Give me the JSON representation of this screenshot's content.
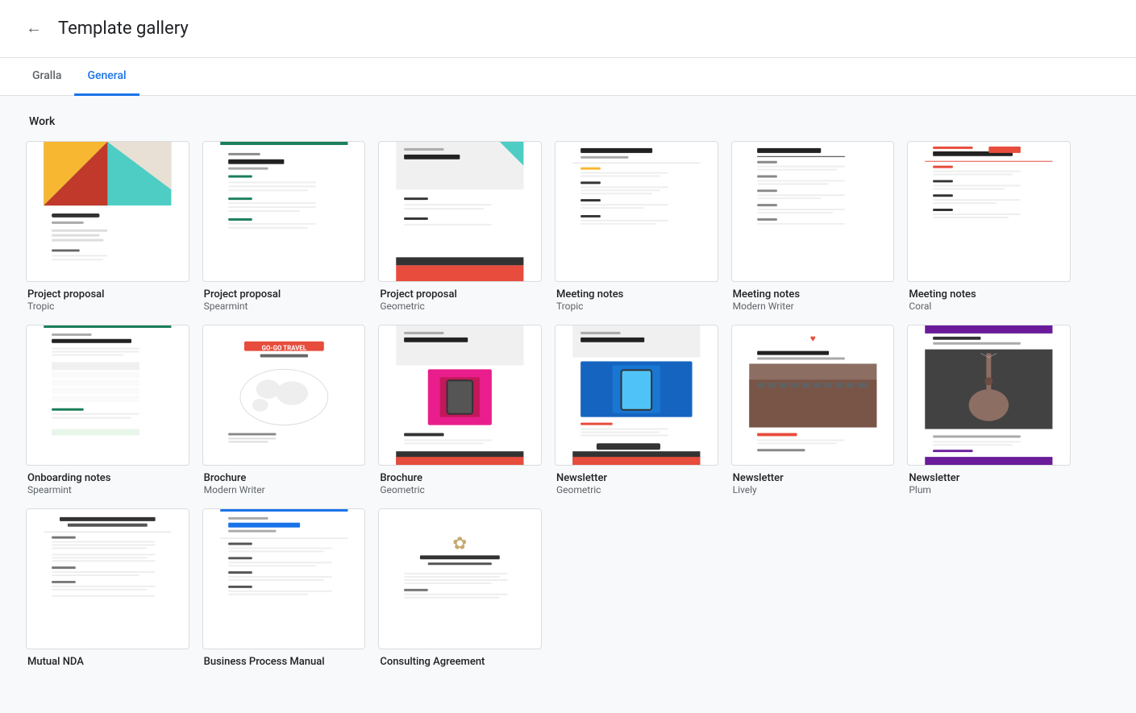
{
  "header": {
    "back_label": "←",
    "title": "Template gallery"
  },
  "tabs": [
    {
      "id": "gralla",
      "label": "Gralla",
      "active": false
    },
    {
      "id": "general",
      "label": "General",
      "active": true
    }
  ],
  "sections": [
    {
      "id": "work",
      "label": "Work",
      "templates": [
        {
          "id": "pp-tropic",
          "name": "Project proposal",
          "sub": "Tropic",
          "thumb_type": "project-proposal-tropic"
        },
        {
          "id": "pp-spearmint",
          "name": "Project proposal",
          "sub": "Spearmint",
          "thumb_type": "project-proposal-spearmint"
        },
        {
          "id": "pp-geometric",
          "name": "Project proposal",
          "sub": "Geometric",
          "thumb_type": "project-proposal-geometric"
        },
        {
          "id": "mn-tropic",
          "name": "Meeting notes",
          "sub": "Tropic",
          "thumb_type": "meeting-notes-tropic"
        },
        {
          "id": "mn-modern",
          "name": "Meeting notes",
          "sub": "Modern Writer",
          "thumb_type": "meeting-notes-modern"
        },
        {
          "id": "mn-coral",
          "name": "Meeting notes",
          "sub": "Coral",
          "thumb_type": "meeting-notes-coral"
        },
        {
          "id": "on-spearmint",
          "name": "Onboarding notes",
          "sub": "Spearmint",
          "thumb_type": "onboarding-spearmint"
        },
        {
          "id": "br-modernwriter",
          "name": "Brochure",
          "sub": "Modern Writer",
          "thumb_type": "brochure-modernwriter"
        },
        {
          "id": "br-geometric",
          "name": "Brochure",
          "sub": "Geometric",
          "thumb_type": "brochure-geometric"
        },
        {
          "id": "nl-geometric",
          "name": "Newsletter",
          "sub": "Geometric",
          "thumb_type": "newsletter-geometric"
        },
        {
          "id": "nl-lively",
          "name": "Newsletter",
          "sub": "Lively",
          "thumb_type": "newsletter-lively"
        },
        {
          "id": "nl-plum",
          "name": "Newsletter",
          "sub": "Plum",
          "thumb_type": "newsletter-plum"
        },
        {
          "id": "nda",
          "name": "Mutual NDA",
          "sub": "",
          "thumb_type": "nda"
        },
        {
          "id": "bpm",
          "name": "Business Process Manual",
          "sub": "",
          "thumb_type": "bpm"
        },
        {
          "id": "consulting",
          "name": "Consulting Agreement",
          "sub": "",
          "thumb_type": "consulting"
        }
      ]
    }
  ]
}
